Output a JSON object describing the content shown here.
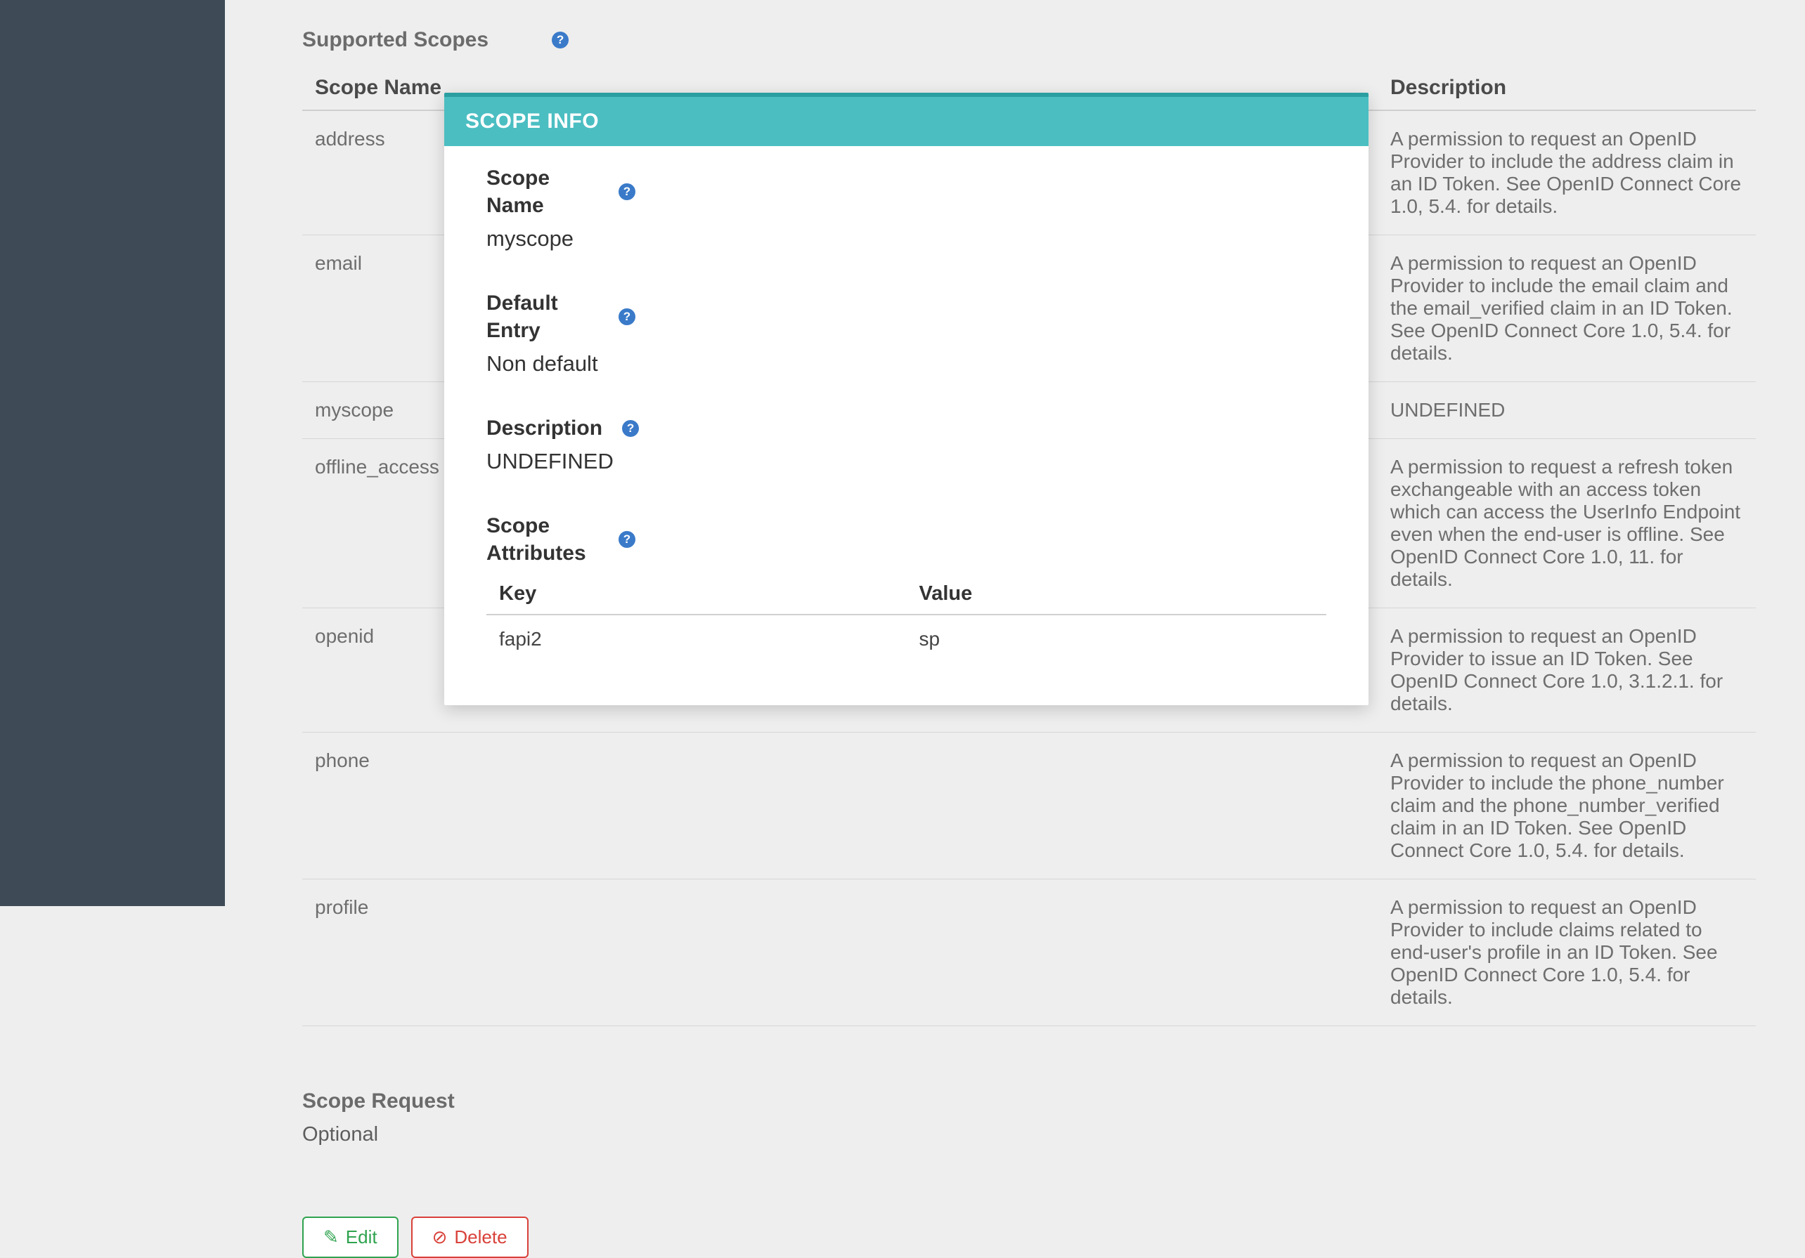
{
  "section": {
    "supported_scopes_title": "Supported Scopes",
    "columns": {
      "name": "Scope Name",
      "description": "Description"
    },
    "scopes": [
      {
        "name": "address",
        "description": "A permission to request an OpenID Provider to include the address claim in an ID Token. See OpenID Connect Core 1.0, 5.4. for details."
      },
      {
        "name": "email",
        "description": "A permission to request an OpenID Provider to include the email claim and the email_verified claim in an ID Token. See OpenID Connect Core 1.0, 5.4. for details."
      },
      {
        "name": "myscope",
        "description": "UNDEFINED"
      },
      {
        "name": "offline_access",
        "description": "A permission to request a refresh token exchangeable with an access token which can access the UserInfo Endpoint even when the end-user is offline. See OpenID Connect Core 1.0, 11. for details."
      },
      {
        "name": "openid",
        "description": "A permission to request an OpenID Provider to issue an ID Token. See OpenID Connect Core 1.0, 3.1.2.1. for details."
      },
      {
        "name": "phone",
        "description": "A permission to request an OpenID Provider to include the phone_number claim and the phone_number_verified claim in an ID Token. See OpenID Connect Core 1.0, 5.4. for details."
      },
      {
        "name": "profile",
        "description": "A permission to request an OpenID Provider to include claims related to end-user's profile in an ID Token. See OpenID Connect Core 1.0, 5.4. for details."
      }
    ],
    "scope_request_label": "Scope Request",
    "scope_request_value": "Optional"
  },
  "modal": {
    "title": "SCOPE INFO",
    "fields": {
      "scope_name_label": "Scope Name",
      "scope_name_value": "myscope",
      "default_entry_label": "Default Entry",
      "default_entry_value": "Non default",
      "description_label": "Description",
      "description_value": "UNDEFINED",
      "scope_attributes_label": "Scope Attributes"
    },
    "attr_columns": {
      "key": "Key",
      "value": "Value"
    },
    "attributes": [
      {
        "key": "fapi2",
        "value": "sp"
      }
    ]
  },
  "buttons": {
    "edit": "Edit",
    "delete": "Delete"
  }
}
